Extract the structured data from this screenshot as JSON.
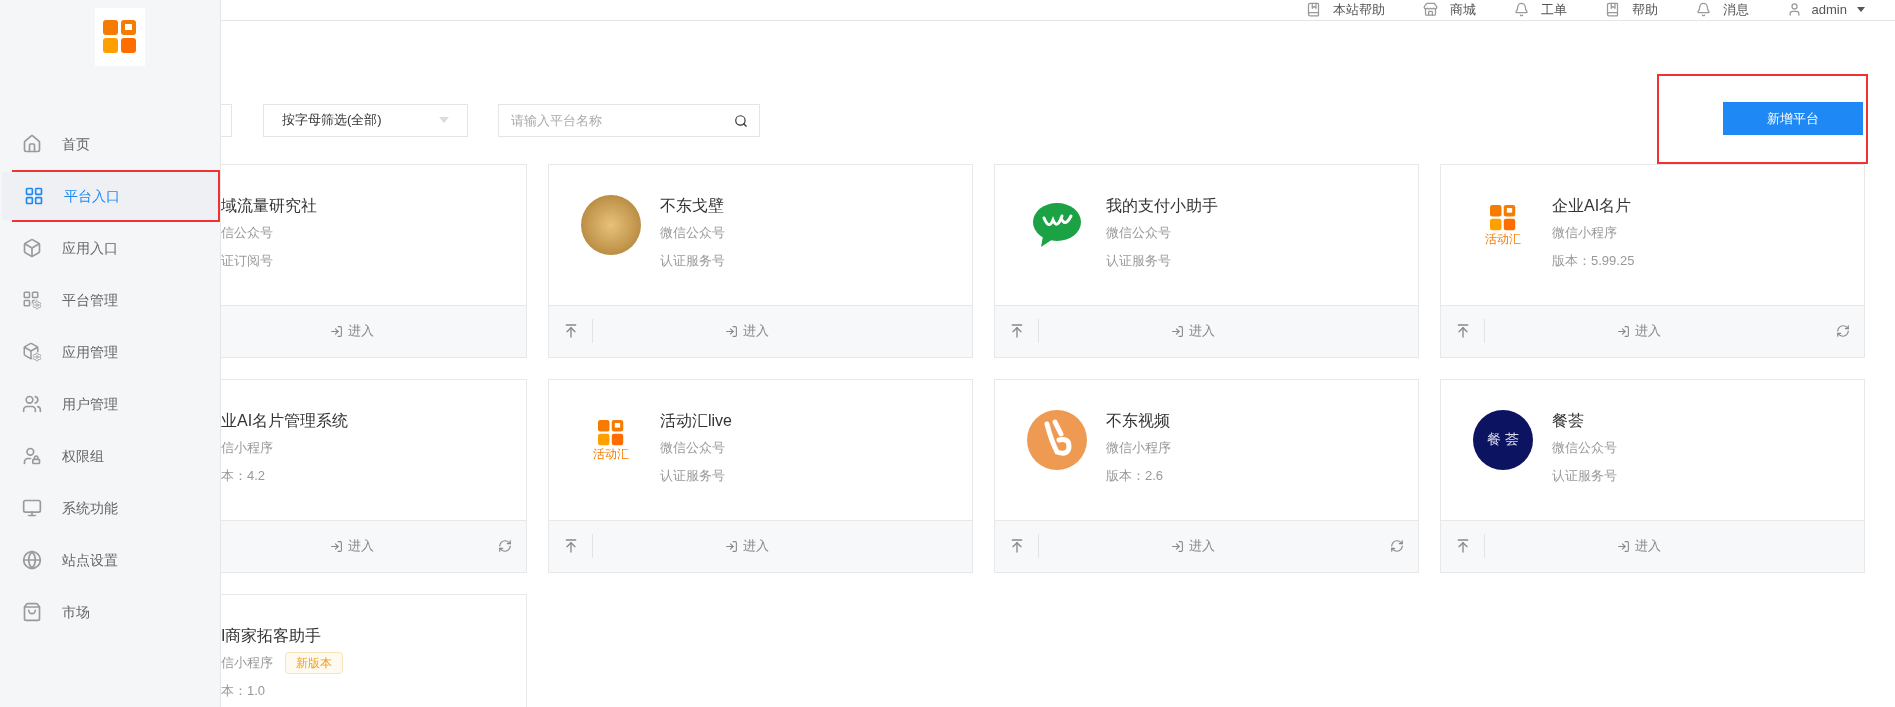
{
  "topbar": {
    "links": [
      {
        "label": "本站帮助"
      },
      {
        "label": "商城"
      },
      {
        "label": "工单"
      },
      {
        "label": "帮助"
      },
      {
        "label": "消息"
      }
    ],
    "user": "admin"
  },
  "sidebar": {
    "items": [
      {
        "label": "首页",
        "selected": false,
        "highlighted": false
      },
      {
        "label": "平台入口",
        "selected": true,
        "highlighted": true
      },
      {
        "label": "应用入口",
        "selected": false,
        "highlighted": false
      },
      {
        "label": "平台管理",
        "selected": false,
        "highlighted": false
      },
      {
        "label": "应用管理",
        "selected": false,
        "highlighted": false
      },
      {
        "label": "用户管理",
        "selected": false,
        "highlighted": false
      },
      {
        "label": "权限组",
        "selected": false,
        "highlighted": false
      },
      {
        "label": "系统功能",
        "selected": false,
        "highlighted": false
      },
      {
        "label": "站点设置",
        "selected": false,
        "highlighted": false
      },
      {
        "label": "市场",
        "selected": false,
        "highlighted": false
      }
    ]
  },
  "filters": {
    "letter_filter": "按字母筛选(全部)",
    "search_placeholder": "请输入平台名称"
  },
  "add_button": {
    "label": "新增平台",
    "highlighted": true
  },
  "cards": [
    {
      "kind": "plain",
      "name": "域流量研究社",
      "type": "信公众号",
      "detail": "证订阅号",
      "pin": false,
      "enter": "进入",
      "refresh": false
    },
    {
      "kind": "photo",
      "name": "不东戈壁",
      "type": "微信公众号",
      "detail": "认证服务号",
      "pin": true,
      "enter": "进入",
      "refresh": false
    },
    {
      "kind": "chat",
      "name": "我的支付小助手",
      "type": "微信公众号",
      "detail": "认证服务号",
      "pin": true,
      "enter": "进入",
      "refresh": false
    },
    {
      "kind": "squares",
      "name": "企业AI名片",
      "type": "微信小程序",
      "detail": "版本：5.99.25",
      "logo_text": "活动汇",
      "pin": true,
      "enter": "进入",
      "refresh": true
    },
    {
      "kind": "plain",
      "name": "业AI名片管理系统",
      "type": "信小程序",
      "detail": "本：4.2",
      "pin": false,
      "enter": "进入",
      "refresh": true
    },
    {
      "kind": "squares",
      "name": "活动汇live",
      "type": "微信公众号",
      "detail": "认证服务号",
      "logo_text": "活动汇",
      "pin": true,
      "enter": "进入",
      "refresh": false
    },
    {
      "kind": "hand",
      "name": "不东视频",
      "type": "微信小程序",
      "detail": "版本：2.6",
      "pin": true,
      "enter": "进入",
      "refresh": true
    },
    {
      "kind": "navy",
      "name": "餐荟",
      "type": "微信公众号",
      "detail": "认证服务号",
      "logo_text": "餐 荟",
      "pin": true,
      "enter": "进入",
      "refresh": false
    },
    {
      "kind": "plain",
      "name": "I商家拓客助手",
      "type": "信小程序",
      "badge": "新版本",
      "detail": "本：1.0"
    }
  ]
}
